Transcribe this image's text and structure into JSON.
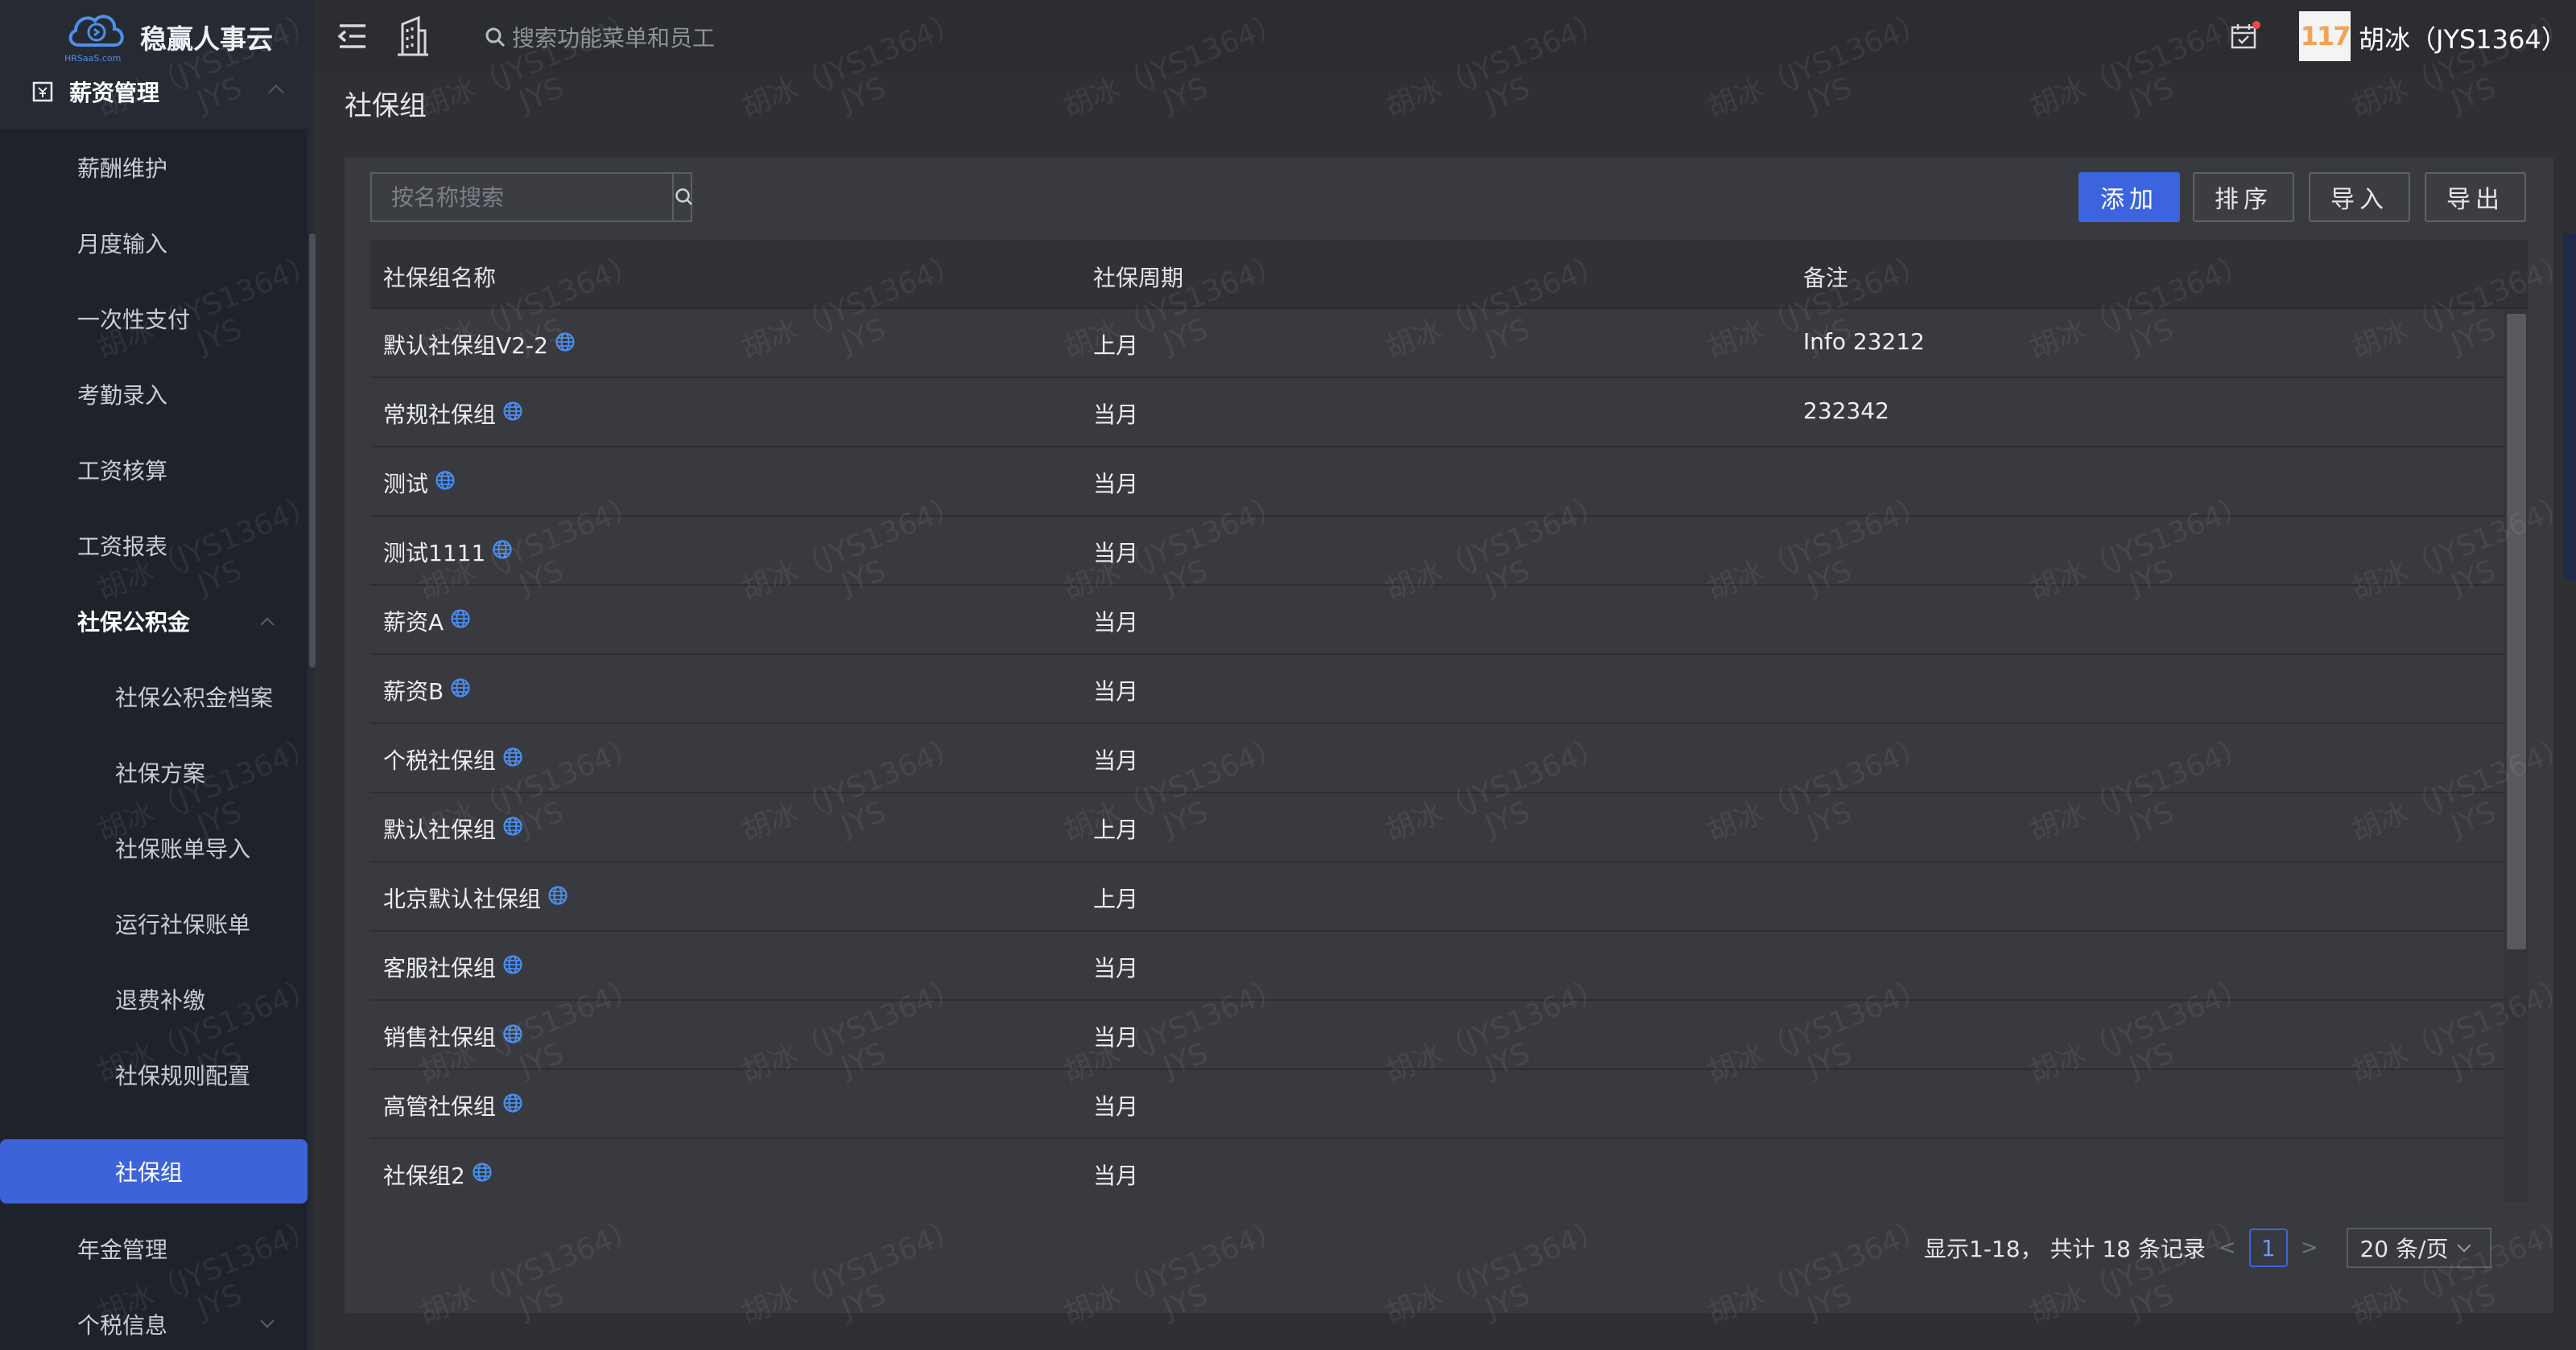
{
  "app": {
    "name": "稳赢人事云",
    "logo_sub": "HRSaaS.com"
  },
  "topbar": {
    "search_placeholder": "搜索功能菜单和员工",
    "avatar_text": "117",
    "user_name": "胡冰（JYS1364）"
  },
  "sidebar": {
    "group_title": "薪资管理",
    "items": [
      {
        "label": "薪酬维护"
      },
      {
        "label": "月度输入"
      },
      {
        "label": "一次性支付"
      },
      {
        "label": "考勤录入"
      },
      {
        "label": "工资核算"
      },
      {
        "label": "工资报表"
      },
      {
        "label": "社保公积金"
      },
      {
        "label": "社保公积金档案"
      },
      {
        "label": "社保方案"
      },
      {
        "label": "社保账单导入"
      },
      {
        "label": "运行社保账单"
      },
      {
        "label": "退费补缴"
      },
      {
        "label": "社保规则配置"
      },
      {
        "label": "社保组"
      },
      {
        "label": "年金管理"
      },
      {
        "label": "个税信息"
      }
    ]
  },
  "page": {
    "title": "社保组",
    "search_placeholder": "按名称搜索"
  },
  "toolbar": {
    "add": "添加",
    "sort": "排序",
    "import": "导入",
    "export": "导出"
  },
  "table": {
    "columns": [
      "社保组名称",
      "社保周期",
      "备注"
    ],
    "rows": [
      {
        "name": "默认社保组V2-2",
        "period": "上月",
        "note": "Info 23212"
      },
      {
        "name": "常规社保组",
        "period": "当月",
        "note": "232342"
      },
      {
        "name": "测试",
        "period": "当月",
        "note": ""
      },
      {
        "name": "测试1111",
        "period": "当月",
        "note": ""
      },
      {
        "name": "薪资A",
        "period": "当月",
        "note": ""
      },
      {
        "name": "薪资B",
        "period": "当月",
        "note": ""
      },
      {
        "name": "个税社保组",
        "period": "当月",
        "note": ""
      },
      {
        "name": "默认社保组",
        "period": "上月",
        "note": ""
      },
      {
        "name": "北京默认社保组",
        "period": "上月",
        "note": ""
      },
      {
        "name": "客服社保组",
        "period": "当月",
        "note": ""
      },
      {
        "name": "销售社保组",
        "period": "当月",
        "note": ""
      },
      {
        "name": "高管社保组",
        "period": "当月",
        "note": ""
      },
      {
        "name": "社保组2",
        "period": "当月",
        "note": ""
      }
    ]
  },
  "pagination": {
    "summary": "显示1-18， 共计 18 条记录",
    "current_page": "1",
    "page_size": "20 条/页"
  },
  "watermark": {
    "line1": "胡冰（JYS1364）",
    "line2": "JYS"
  },
  "colors": {
    "accent": "#3b64de",
    "sidebar_bg": "#262a33",
    "content_bg": "#383a3f"
  }
}
